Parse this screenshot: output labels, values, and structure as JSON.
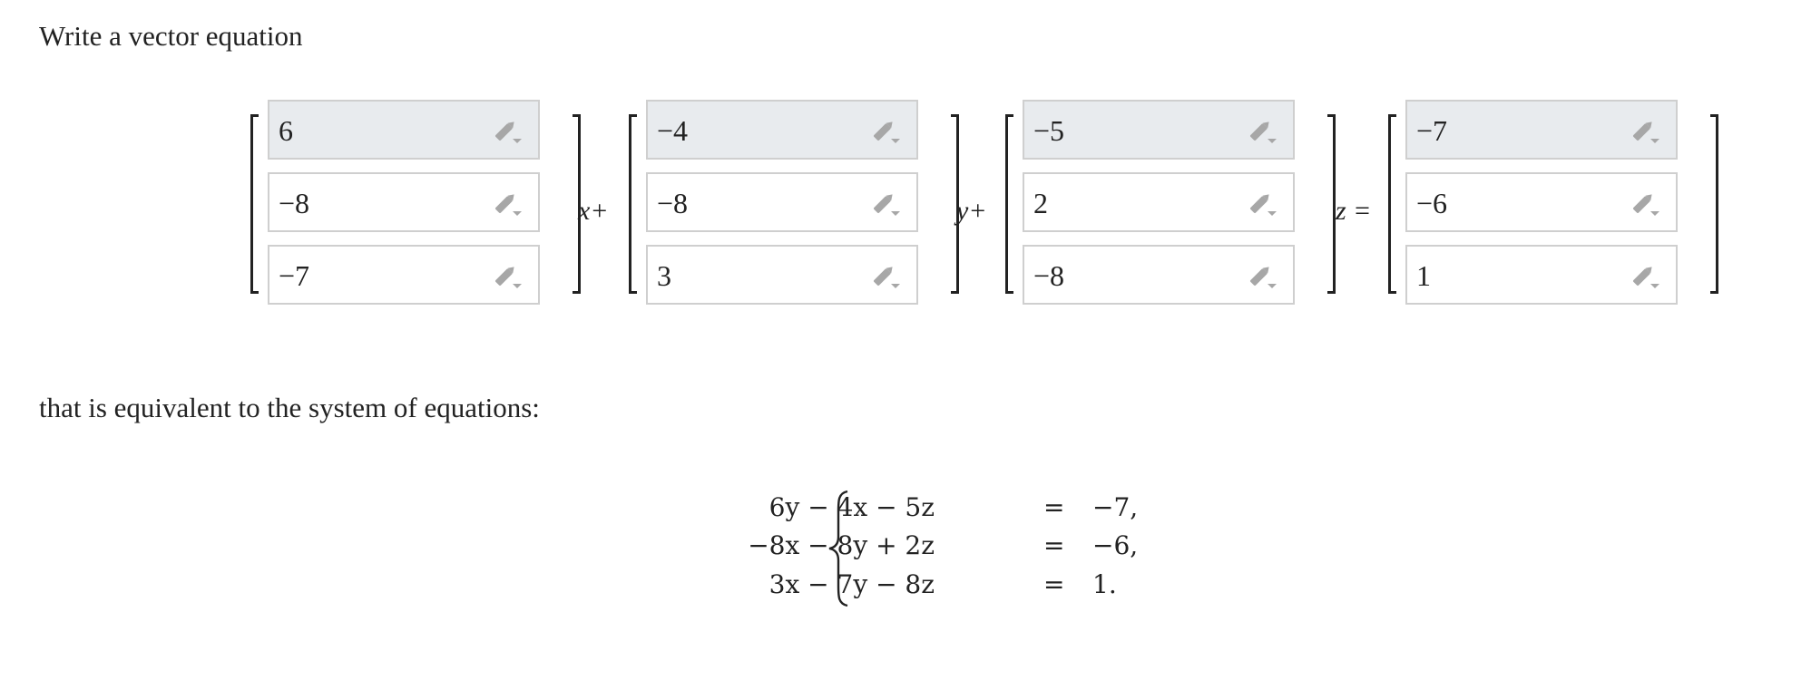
{
  "prompt": {
    "intro": "Write a vector equation",
    "followup": "that is equivalent to the system of equations:"
  },
  "vector_equation": {
    "vectors": [
      {
        "values": [
          "6",
          "−8",
          "−7"
        ],
        "operator": "x+"
      },
      {
        "values": [
          "−4",
          "−8",
          "3"
        ],
        "operator": "y+"
      },
      {
        "values": [
          "−5",
          "2",
          "−8"
        ],
        "operator": "z ="
      },
      {
        "values": [
          "−7",
          "−6",
          "1"
        ],
        "operator": ""
      }
    ],
    "edit_icon": "pencil-dropdown-icon",
    "focused_row_color": "#e8ebee"
  },
  "system": {
    "equations": [
      {
        "lhs": "6y − 4x − 5z",
        "eq": "=",
        "rhs": "−7,"
      },
      {
        "lhs": "−8x − 8y + 2z",
        "eq": "=",
        "rhs": "−6,"
      },
      {
        "lhs": "3x − 7y − 8z",
        "eq": "=",
        "rhs": "1."
      }
    ]
  }
}
